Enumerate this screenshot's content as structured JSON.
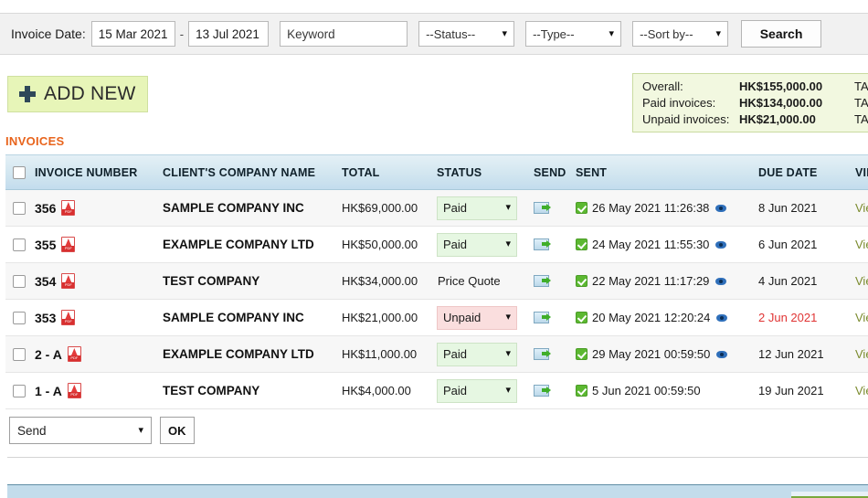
{
  "search": {
    "date_label": "Invoice Date:",
    "date_from": "15 Mar 2021",
    "dash": "-",
    "date_to": "13 Jul 2021",
    "keyword_placeholder": "Keyword",
    "keyword_value": "Keyword",
    "status_select": "--Status--",
    "type_select": "--Type--",
    "sort_select": "--Sort by--",
    "search_button": "Search",
    "caret": "⌄"
  },
  "add_new": {
    "label": "ADD NEW",
    "icon": "plus-icon"
  },
  "summary": {
    "rows": [
      {
        "key": "Overall:",
        "value": "HK$155,000.00",
        "tax": "TAX"
      },
      {
        "key": "Paid invoices:",
        "value": "HK$134,000.00",
        "tax": "TAX"
      },
      {
        "key": "Unpaid invoices:",
        "value": "HK$21,000.00",
        "tax": "TAX"
      }
    ]
  },
  "section_title": "INVOICES",
  "table": {
    "headers": {
      "checkbox": "",
      "invoice_number": "INVOICE NUMBER",
      "company": "CLIENT'S COMPANY NAME",
      "total": "TOTAL",
      "status": "STATUS",
      "send": "SEND",
      "sent": "SENT",
      "due_date": "DUE DATE",
      "view": "VIEW"
    },
    "rows": [
      {
        "number": "356",
        "company": "SAMPLE COMPANY INC",
        "total": "HK$69,000.00",
        "status": "Paid",
        "status_kind": "paid",
        "sent": "26 May 2021 11:26:38",
        "has_eye": true,
        "due": "8 Jun 2021",
        "due_overdue": false,
        "view": "View"
      },
      {
        "number": "355",
        "company": "EXAMPLE COMPANY LTD",
        "total": "HK$50,000.00",
        "status": "Paid",
        "status_kind": "paid",
        "sent": "24 May 2021 11:55:30",
        "has_eye": true,
        "due": "6 Jun 2021",
        "due_overdue": false,
        "view": "View"
      },
      {
        "number": "354",
        "company": "TEST COMPANY",
        "total": "HK$34,000.00",
        "status": "Price Quote",
        "status_kind": "plain",
        "sent": "22 May 2021 11:17:29",
        "has_eye": true,
        "due": "4 Jun 2021",
        "due_overdue": false,
        "view": "View"
      },
      {
        "number": "353",
        "company": "SAMPLE COMPANY INC",
        "total": "HK$21,000.00",
        "status": "Unpaid",
        "status_kind": "unpaid",
        "sent": "20 May 2021 12:20:24",
        "has_eye": true,
        "due": "2 Jun 2021",
        "due_overdue": true,
        "view": "View"
      },
      {
        "number": "2 - A",
        "company": "EXAMPLE COMPANY LTD",
        "total": "HK$11,000.00",
        "status": "Paid",
        "status_kind": "paid",
        "sent": "29 May 2021 00:59:50",
        "has_eye": true,
        "due": "12 Jun 2021",
        "due_overdue": false,
        "view": "View"
      },
      {
        "number": "1 - A",
        "company": "TEST COMPANY",
        "total": "HK$4,000.00",
        "status": "Paid",
        "status_kind": "paid",
        "sent": "5 Jun 2021 00:59:50",
        "has_eye": false,
        "due": "19 Jun 2021",
        "due_overdue": false,
        "view": "View"
      }
    ]
  },
  "bulk_action": {
    "selected": "Send",
    "ok_label": "OK",
    "caret": "⌄"
  },
  "colors": {
    "accent_orange": "#e8641c",
    "paid_bg": "#e6f7e2",
    "unpaid_bg": "#fadede",
    "overdue_text": "#e03434",
    "view_link": "#7b8b2e",
    "header_blue": "#c3dced",
    "addnew_green": "#e7f5b8",
    "summary_green": "#f2f8e0"
  }
}
